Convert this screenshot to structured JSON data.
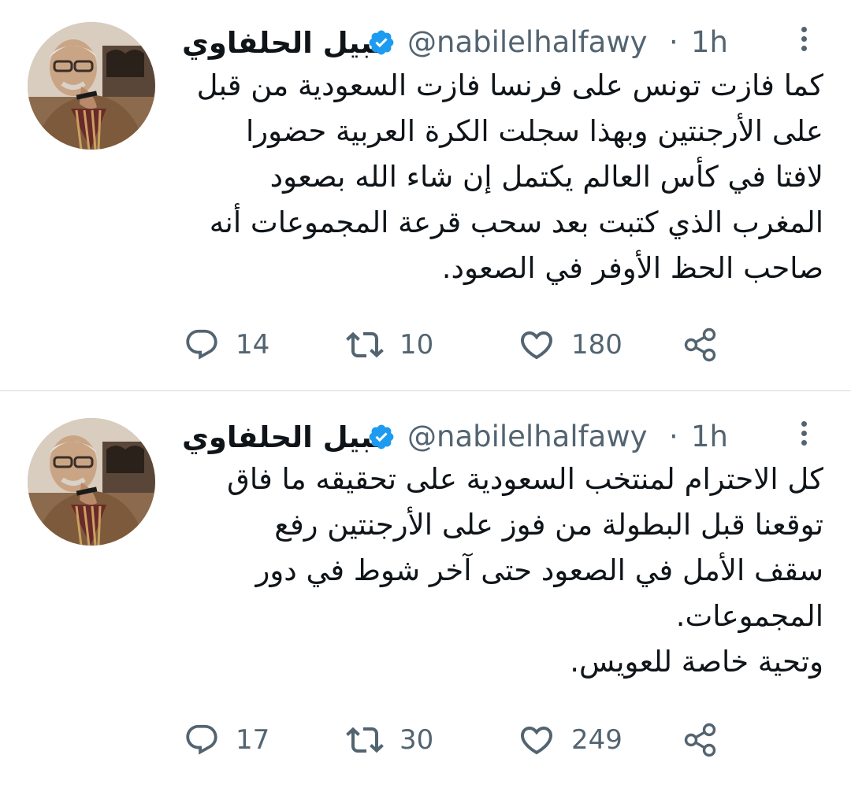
{
  "tweets": [
    {
      "author": {
        "name": "نبيل الحلفاوي",
        "handle": "@nabilelhalfawy",
        "verified": true
      },
      "separator": "·",
      "time": "1h",
      "text_lines": [
        "كما فازت تونس على فرنسا فازت السعودية من قبل",
        "على الأرجنتين وبهذا سجلت الكرة العربية حضورا",
        "لافتا في كأس العالم يكتمل إن شاء الله بصعود",
        "المغرب الذي كتبت بعد سحب قرعة المجموعات أنه",
        "صاحب الحظ الأوفر في الصعود."
      ],
      "stats": {
        "replies": "14",
        "retweets": "10",
        "likes": "180"
      },
      "icons": {
        "reply": "reply-icon",
        "retweet": "retweet-icon",
        "like": "heart-icon",
        "share": "share-icon",
        "more": "more-vertical-icon"
      }
    },
    {
      "author": {
        "name": "نبيل الحلفاوي",
        "handle": "@nabilelhalfawy",
        "verified": true
      },
      "separator": "·",
      "time": "1h",
      "text_lines": [
        "كل الاحترام لمنتخب السعودية على تحقيقه ما فاق",
        "توقعنا قبل البطولة من فوز على الأرجنتين رفع",
        "سقف الأمل في الصعود حتى آخر شوط في دور",
        "المجموعات.",
        "وتحية خاصة للعويس."
      ],
      "stats": {
        "replies": "17",
        "retweets": "30",
        "likes": "249"
      },
      "icons": {
        "reply": "reply-icon",
        "retweet": "retweet-icon",
        "like": "heart-icon",
        "share": "share-icon",
        "more": "more-vertical-icon"
      }
    }
  ],
  "colors": {
    "text": "#0f1419",
    "secondary": "#536471",
    "verified": "#1d9bf0",
    "divider": "#d6dbdf"
  }
}
